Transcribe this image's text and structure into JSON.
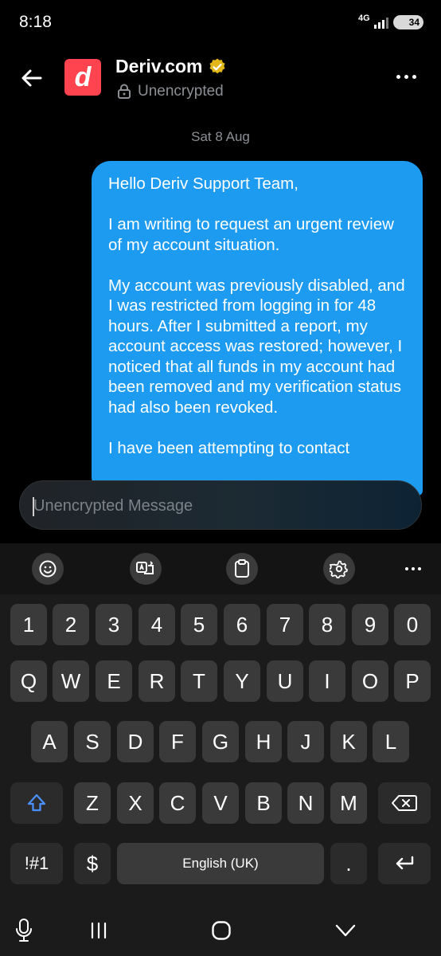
{
  "status_bar": {
    "time": "8:18",
    "network": "4G",
    "battery": "34"
  },
  "header": {
    "contact_name": "Deriv.com",
    "avatar_letter": "d",
    "encryption_status": "Unencrypted",
    "icons": [
      "back-arrow-icon",
      "verified-badge-icon",
      "lock-icon",
      "more-options-icon"
    ],
    "colors": {
      "avatar": "#ff444f",
      "badge": "#e2b719"
    }
  },
  "conversation": {
    "date": "Sat 8 Aug",
    "message_paragraphs": [
      "Hello Deriv Support Team,",
      "I am writing to request an urgent review of my account situation.",
      "My account was previously disabled, and I was restricted from logging in for 48 hours. After I submitted a report, my account access was restored; however, I noticed that all funds in my account had been removed and my verification status had also been revoked.",
      "I have been attempting to contact"
    ],
    "bubble_color": "#1d9bf0"
  },
  "composer": {
    "placeholder": "Unencrypted Message",
    "value": ""
  },
  "keyboard": {
    "toolbar_icons": [
      "emoji-icon",
      "translate-icon",
      "clipboard-icon",
      "settings-icon",
      "more-icon"
    ],
    "row_numbers": [
      "1",
      "2",
      "3",
      "4",
      "5",
      "6",
      "7",
      "8",
      "9",
      "0"
    ],
    "row_top": [
      "Q",
      "W",
      "E",
      "R",
      "T",
      "Y",
      "U",
      "I",
      "O",
      "P"
    ],
    "row_middle": [
      "A",
      "S",
      "D",
      "F",
      "G",
      "H",
      "J",
      "K",
      "L"
    ],
    "row_bottom": [
      "Z",
      "X",
      "C",
      "V",
      "B",
      "N",
      "M"
    ],
    "symbols_key": "!#1",
    "currency_key": "$",
    "space_label": "English (UK)",
    "period_key": ".",
    "shift_color": "#4a90ff"
  },
  "navigation_bar": {
    "icons": [
      "microphone-icon",
      "recent-apps-icon",
      "home-icon",
      "hide-keyboard-icon"
    ]
  }
}
